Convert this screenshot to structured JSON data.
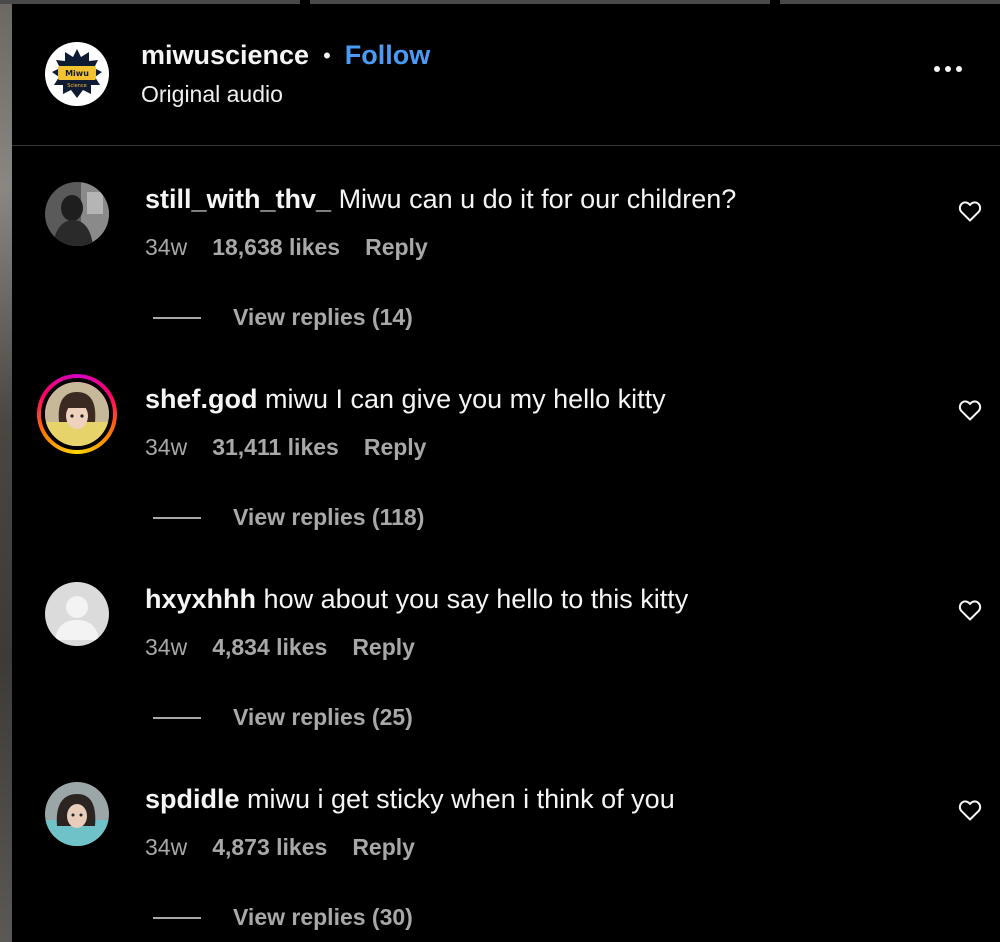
{
  "header": {
    "account_name": "miwuscience",
    "separator": "•",
    "follow_label": "Follow",
    "audio_label": "Original audio",
    "logo_text": "Miwu Science",
    "more_icon": "more-horizontal-icon"
  },
  "comments": [
    {
      "username": "still_with_thv_",
      "text": "Miwu can u do it for our children?",
      "age": "34w",
      "likes": "18,638 likes",
      "reply_label": "Reply",
      "view_replies": "View replies (14)",
      "has_story_ring": false
    },
    {
      "username": "shef.god",
      "text": "miwu I can give you my hello kitty",
      "age": "34w",
      "likes": "31,411 likes",
      "reply_label": "Reply",
      "view_replies": "View replies (118)",
      "has_story_ring": true
    },
    {
      "username": "hxyxhhh",
      "text": "how about you say hello to this kitty",
      "age": "34w",
      "likes": "4,834 likes",
      "reply_label": "Reply",
      "view_replies": "View replies (25)",
      "has_story_ring": false
    },
    {
      "username": "spdidle",
      "text": "miwu i get sticky when i think of you",
      "age": "34w",
      "likes": "4,873 likes",
      "reply_label": "Reply",
      "view_replies": "View replies (30)",
      "has_story_ring": false
    }
  ],
  "colors": {
    "background": "#000000",
    "text": "#f5f5f5",
    "secondary_text": "#a8a8a8",
    "follow_blue": "#4a9bf5",
    "divider": "#363636"
  }
}
